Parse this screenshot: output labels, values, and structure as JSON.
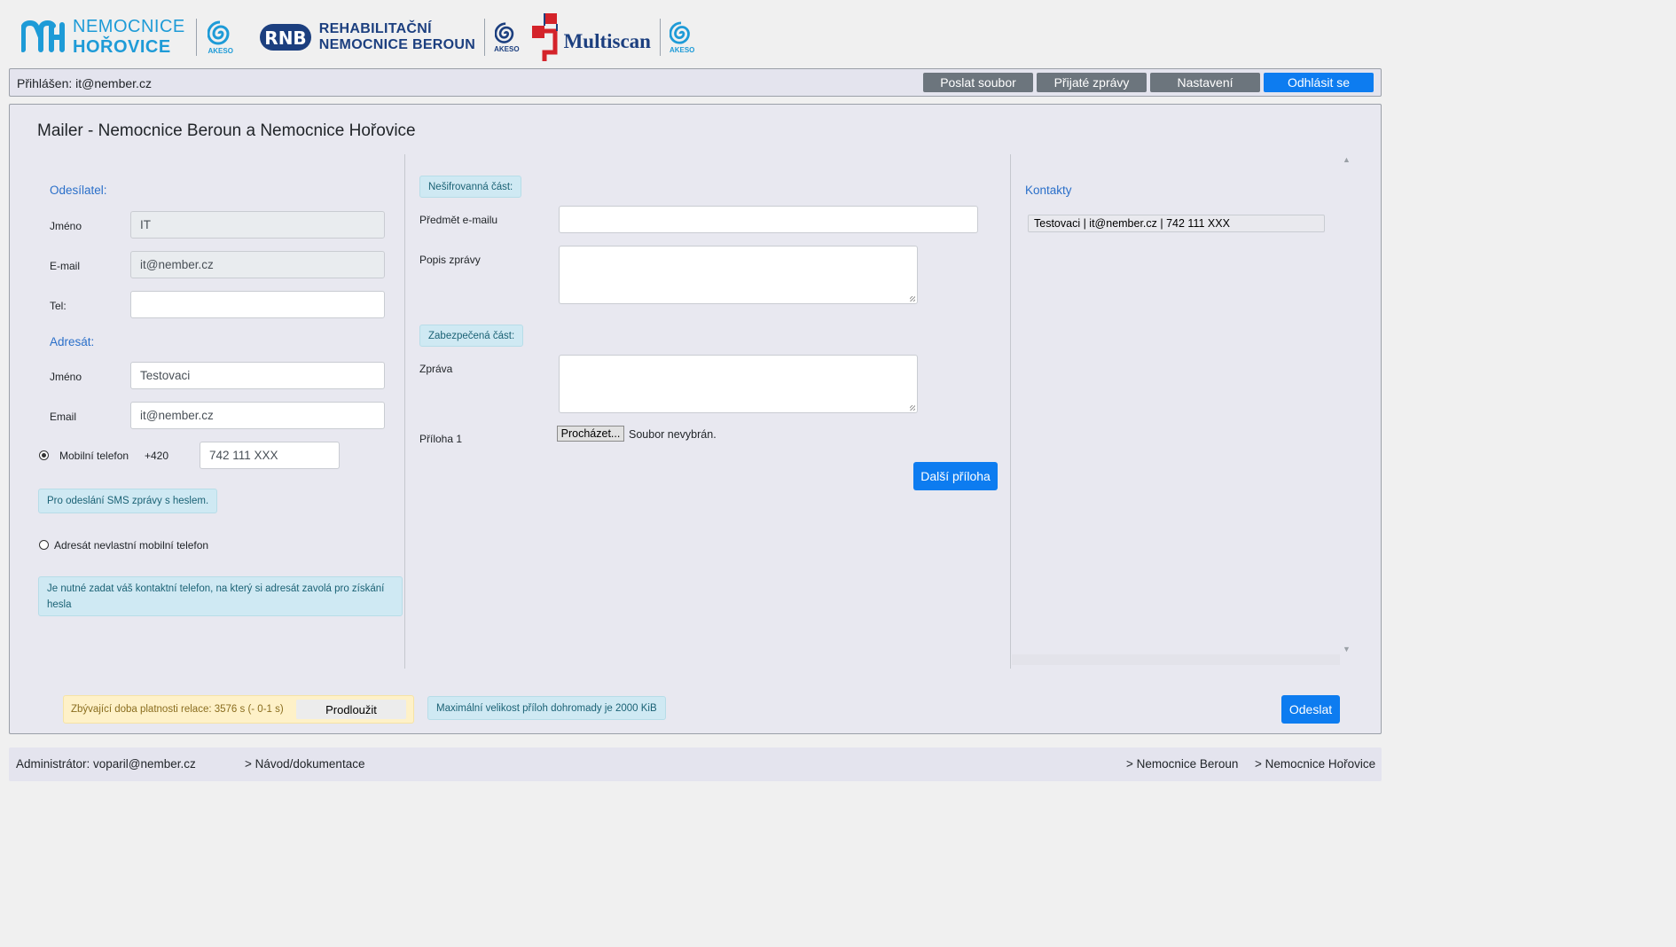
{
  "logos": {
    "nh_line1": "NEMOCNICE",
    "nh_line2": "HOŘOVICE",
    "akeso": "AKESO",
    "rnb_mark": "RNB",
    "rnb_line1": "REHABILITAČNÍ",
    "rnb_line2": "NEMOCNICE BEROUN",
    "multiscan": "Multiscan"
  },
  "topbar": {
    "login_text": "Přihlášen: it@nember.cz",
    "send_file": "Poslat soubor",
    "received": "Přijaté zprávy",
    "settings": "Nastavení",
    "logout": "Odhlásit se"
  },
  "page_title": "Mailer - Nemocnice Beroun a Nemocnice Hořovice",
  "sender": {
    "title": "Odesílatel:",
    "name_label": "Jméno",
    "name_value": "IT",
    "email_label": "E-mail",
    "email_value": "it@nember.cz",
    "tel_label": "Tel:",
    "tel_value": ""
  },
  "recipient": {
    "title": "Adresát:",
    "name_label": "Jméno",
    "name_value": "Testovaci",
    "email_label": "Email",
    "email_value": "it@nember.cz",
    "mobile_label": "Mobilní telefon",
    "mobile_prefix": "+420",
    "mobile_value": "742 111 XXX",
    "sms_info": "Pro odeslání SMS zprávy s heslem.",
    "no_mobile_label": "Adresát nevlastní mobilní telefon",
    "contact_info": "Je nutné zadat váš kontaktní telefon, na který si adresát zavolá pro získání hesla"
  },
  "message": {
    "unencrypted_badge": "Nešifrovanná část:",
    "subject_label": "Předmět e-mailu",
    "subject_value": "",
    "desc_label": "Popis zprávy",
    "secured_badge": "Zabezpečená část:",
    "message_label": "Zpráva",
    "attachment_label": "Příloha 1",
    "browse_button": "Procházet...",
    "no_file": "Soubor nevybrán.",
    "next_attachment": "Další příloha"
  },
  "contacts": {
    "title": "Kontakty",
    "items": [
      "Testovaci | it@nember.cz | 742 111 XXX"
    ]
  },
  "bottom": {
    "session_text": "Zbývající doba platnosti relace: 3576 s (- 0-1 s)",
    "prolong": "Prodloužit",
    "max_size": "Maximální velikost příloh dohromady je 2000 KiB",
    "send": "Odeslat"
  },
  "footer": {
    "admin": "Administrátor: voparil@nember.cz",
    "docs": "> Návod/dokumentace",
    "link1": "> Nemocnice Beroun",
    "link2": "> Nemocnice Hořovice"
  },
  "colors": {
    "primary": "#0d7cf0",
    "secondary": "#6c757d",
    "brand_blue": "#1e9bd7",
    "brand_navy": "#1c3f7f",
    "brand_red": "#d4232a"
  }
}
